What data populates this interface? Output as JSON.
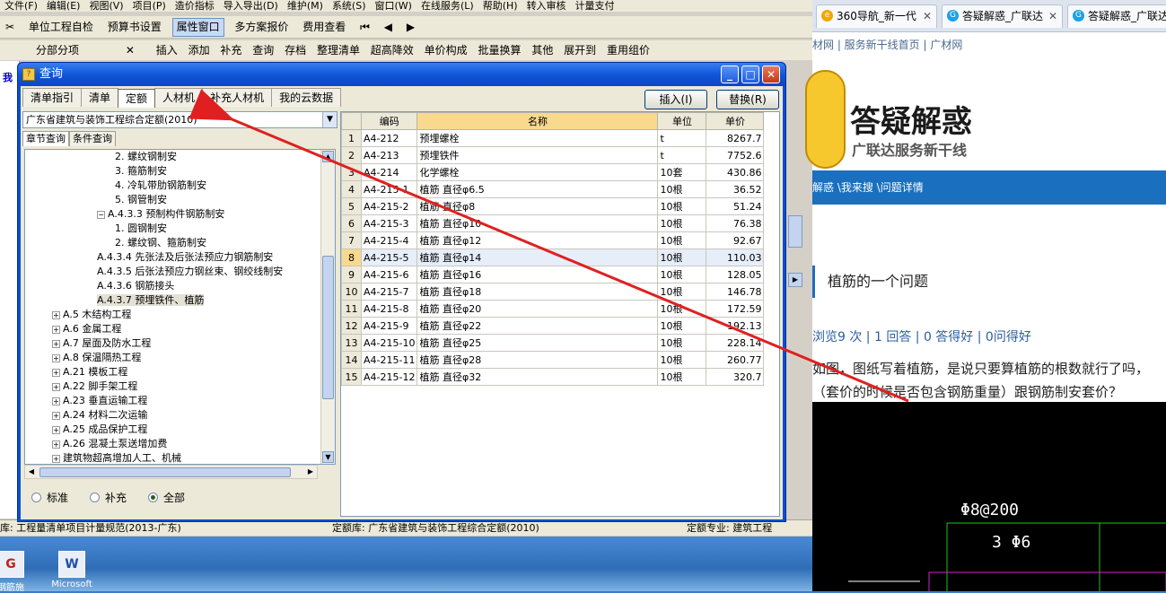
{
  "app": {
    "menu": [
      "文件(F)",
      "编辑(E)",
      "视图(V)",
      "项目(P)",
      "造价指标",
      "导入导出(D)",
      "维护(M)",
      "系统(S)",
      "窗口(W)",
      "在线服务(L)",
      "帮助(H)",
      "转入审核",
      "计量支付"
    ],
    "toolbar1": {
      "unit_self_check": "单位工程自检",
      "budget_settings": "预算书设置",
      "property_window": "属性窗口",
      "multi_plan_quote": "多方案报价",
      "fee_view": "费用查看"
    },
    "toolbar2": {
      "section_label": "分部分项",
      "items": [
        "插入",
        "添加",
        "补充",
        "查询",
        "存档"
      ],
      "items2": [
        "整理清单",
        "超高降效",
        "单价构成",
        "批量换算",
        "其他",
        "展开到",
        "重用组价"
      ]
    },
    "left_strip_text": "我",
    "status": {
      "lib": "库: 工程量清单项目计量规范(2013-广东)",
      "quota_lib": "定额库: 广东省建筑与装饰工程综合定额(2010)",
      "quota_major": "定额专业: 建筑工程"
    }
  },
  "dialog": {
    "title": "查询",
    "tabs": [
      "清单指引",
      "清单",
      "定额",
      "人材机",
      "补充人材机",
      "我的云数据"
    ],
    "selected_tab": "定额",
    "insert_btn": "插入(I)",
    "replace_btn": "替换(R)",
    "quota_library": "广东省建筑与装饰工程综合定额(2010)",
    "subtabs": [
      "章节查询",
      "条件查询"
    ],
    "tree": [
      {
        "label": "2. 螺纹钢制安",
        "level": 4,
        "toggle": ""
      },
      {
        "label": "3. 箍筋制安",
        "level": 4,
        "toggle": ""
      },
      {
        "label": "4. 冷轧带肋钢筋制安",
        "level": 4,
        "toggle": ""
      },
      {
        "label": "5. 钢管制安",
        "level": 4,
        "toggle": ""
      },
      {
        "label": "A.4.3.3 预制构件钢筋制安",
        "level": 3,
        "toggle": "−"
      },
      {
        "label": "1. 圆钢制安",
        "level": 4,
        "toggle": ""
      },
      {
        "label": "2. 螺纹钢、箍筋制安",
        "level": 4,
        "toggle": ""
      },
      {
        "label": "A.4.3.4 先张法及后张法预应力钢筋制安",
        "level": 3,
        "toggle": ""
      },
      {
        "label": "A.4.3.5 后张法预应力钢丝束、钢绞线制安",
        "level": 3,
        "toggle": ""
      },
      {
        "label": "A.4.3.6 钢筋接头",
        "level": 3,
        "toggle": ""
      },
      {
        "label": "A.4.3.7 预埋铁件、植筋",
        "level": 3,
        "toggle": "",
        "selected": true
      },
      {
        "label": "A.5 木结构工程",
        "level": 1,
        "toggle": "+"
      },
      {
        "label": "A.6 金属工程",
        "level": 1,
        "toggle": "+"
      },
      {
        "label": "A.7 屋面及防水工程",
        "level": 1,
        "toggle": "+"
      },
      {
        "label": "A.8 保温隔热工程",
        "level": 1,
        "toggle": "+"
      },
      {
        "label": "A.21 模板工程",
        "level": 1,
        "toggle": "+"
      },
      {
        "label": "A.22 脚手架工程",
        "level": 1,
        "toggle": "+"
      },
      {
        "label": "A.23 垂直运输工程",
        "level": 1,
        "toggle": "+"
      },
      {
        "label": "A.24 材料二次运输",
        "level": 1,
        "toggle": "+"
      },
      {
        "label": "A.25 成品保护工程",
        "level": 1,
        "toggle": "+"
      },
      {
        "label": "A.26 混凝土泵送增加费",
        "level": 1,
        "toggle": "+"
      },
      {
        "label": "建筑物超高增加人工、机械",
        "level": 1,
        "toggle": "+"
      }
    ],
    "radios": [
      "标准",
      "补充",
      "全部"
    ],
    "radio_checked": "全部",
    "table": {
      "headers": [
        "编码",
        "名称",
        "单位",
        "单价"
      ],
      "rows": [
        [
          "1",
          "A4-212",
          "预埋螺栓",
          "t",
          "8267.7"
        ],
        [
          "2",
          "A4-213",
          "预埋铁件",
          "t",
          "7752.6"
        ],
        [
          "3",
          "A4-214",
          "化学螺栓",
          "10套",
          "430.86"
        ],
        [
          "4",
          "A4-215-1",
          "植筋 直径φ6.5",
          "10根",
          "36.52"
        ],
        [
          "5",
          "A4-215-2",
          "植筋 直径φ8",
          "10根",
          "51.24"
        ],
        [
          "6",
          "A4-215-3",
          "植筋 直径φ10",
          "10根",
          "76.38"
        ],
        [
          "7",
          "A4-215-4",
          "植筋 直径φ12",
          "10根",
          "92.67"
        ],
        [
          "8",
          "A4-215-5",
          "植筋 直径φ14",
          "10根",
          "110.03"
        ],
        [
          "9",
          "A4-215-6",
          "植筋 直径φ16",
          "10根",
          "128.05"
        ],
        [
          "10",
          "A4-215-7",
          "植筋 直径φ18",
          "10根",
          "146.78"
        ],
        [
          "11",
          "A4-215-8",
          "植筋 直径φ20",
          "10根",
          "172.59"
        ],
        [
          "12",
          "A4-215-9",
          "植筋 直径φ22",
          "10根",
          "192.13"
        ],
        [
          "13",
          "A4-215-10",
          "植筋 直径φ25",
          "10根",
          "228.14"
        ],
        [
          "14",
          "A4-215-11",
          "植筋 直径φ28",
          "10根",
          "260.77"
        ],
        [
          "15",
          "A4-215-12",
          "植筋 直径φ32",
          "10根",
          "320.7"
        ]
      ],
      "selected_row": 8
    }
  },
  "desktop": {
    "icons": [
      {
        "label": "钢筋施",
        "badge": "G"
      },
      {
        "label": "Microsoft",
        "badge": "W"
      }
    ]
  },
  "browser": {
    "tabs": [
      "360导航_新一代",
      "答疑解惑_广联达",
      "答疑解惑_广联达"
    ],
    "topnav": "材网 | 服务新干线首页 | 广材网",
    "site_title": "答疑解惑",
    "site_sub": "广联达服务新干线",
    "breadcrumb": "解惑 \\我来搜 \\问题详情",
    "question_title": "植筋的一个问题",
    "stats": "浏览9 次 | 1 回答 | 0 答得好 | 0问得好",
    "body_line1": "如图，图纸写着植筋，是说只要算植筋的根数就行了吗，",
    "body_line2": "（套价的时候是否包含钢筋重量）跟钢筋制安套价？",
    "drawing_text1": "Φ8@200",
    "drawing_text2": "3 Φ6"
  },
  "colors": {
    "arrow": "#e02020",
    "title_bar": "#0a4fd0",
    "header_highlight": "#f8d98e"
  }
}
